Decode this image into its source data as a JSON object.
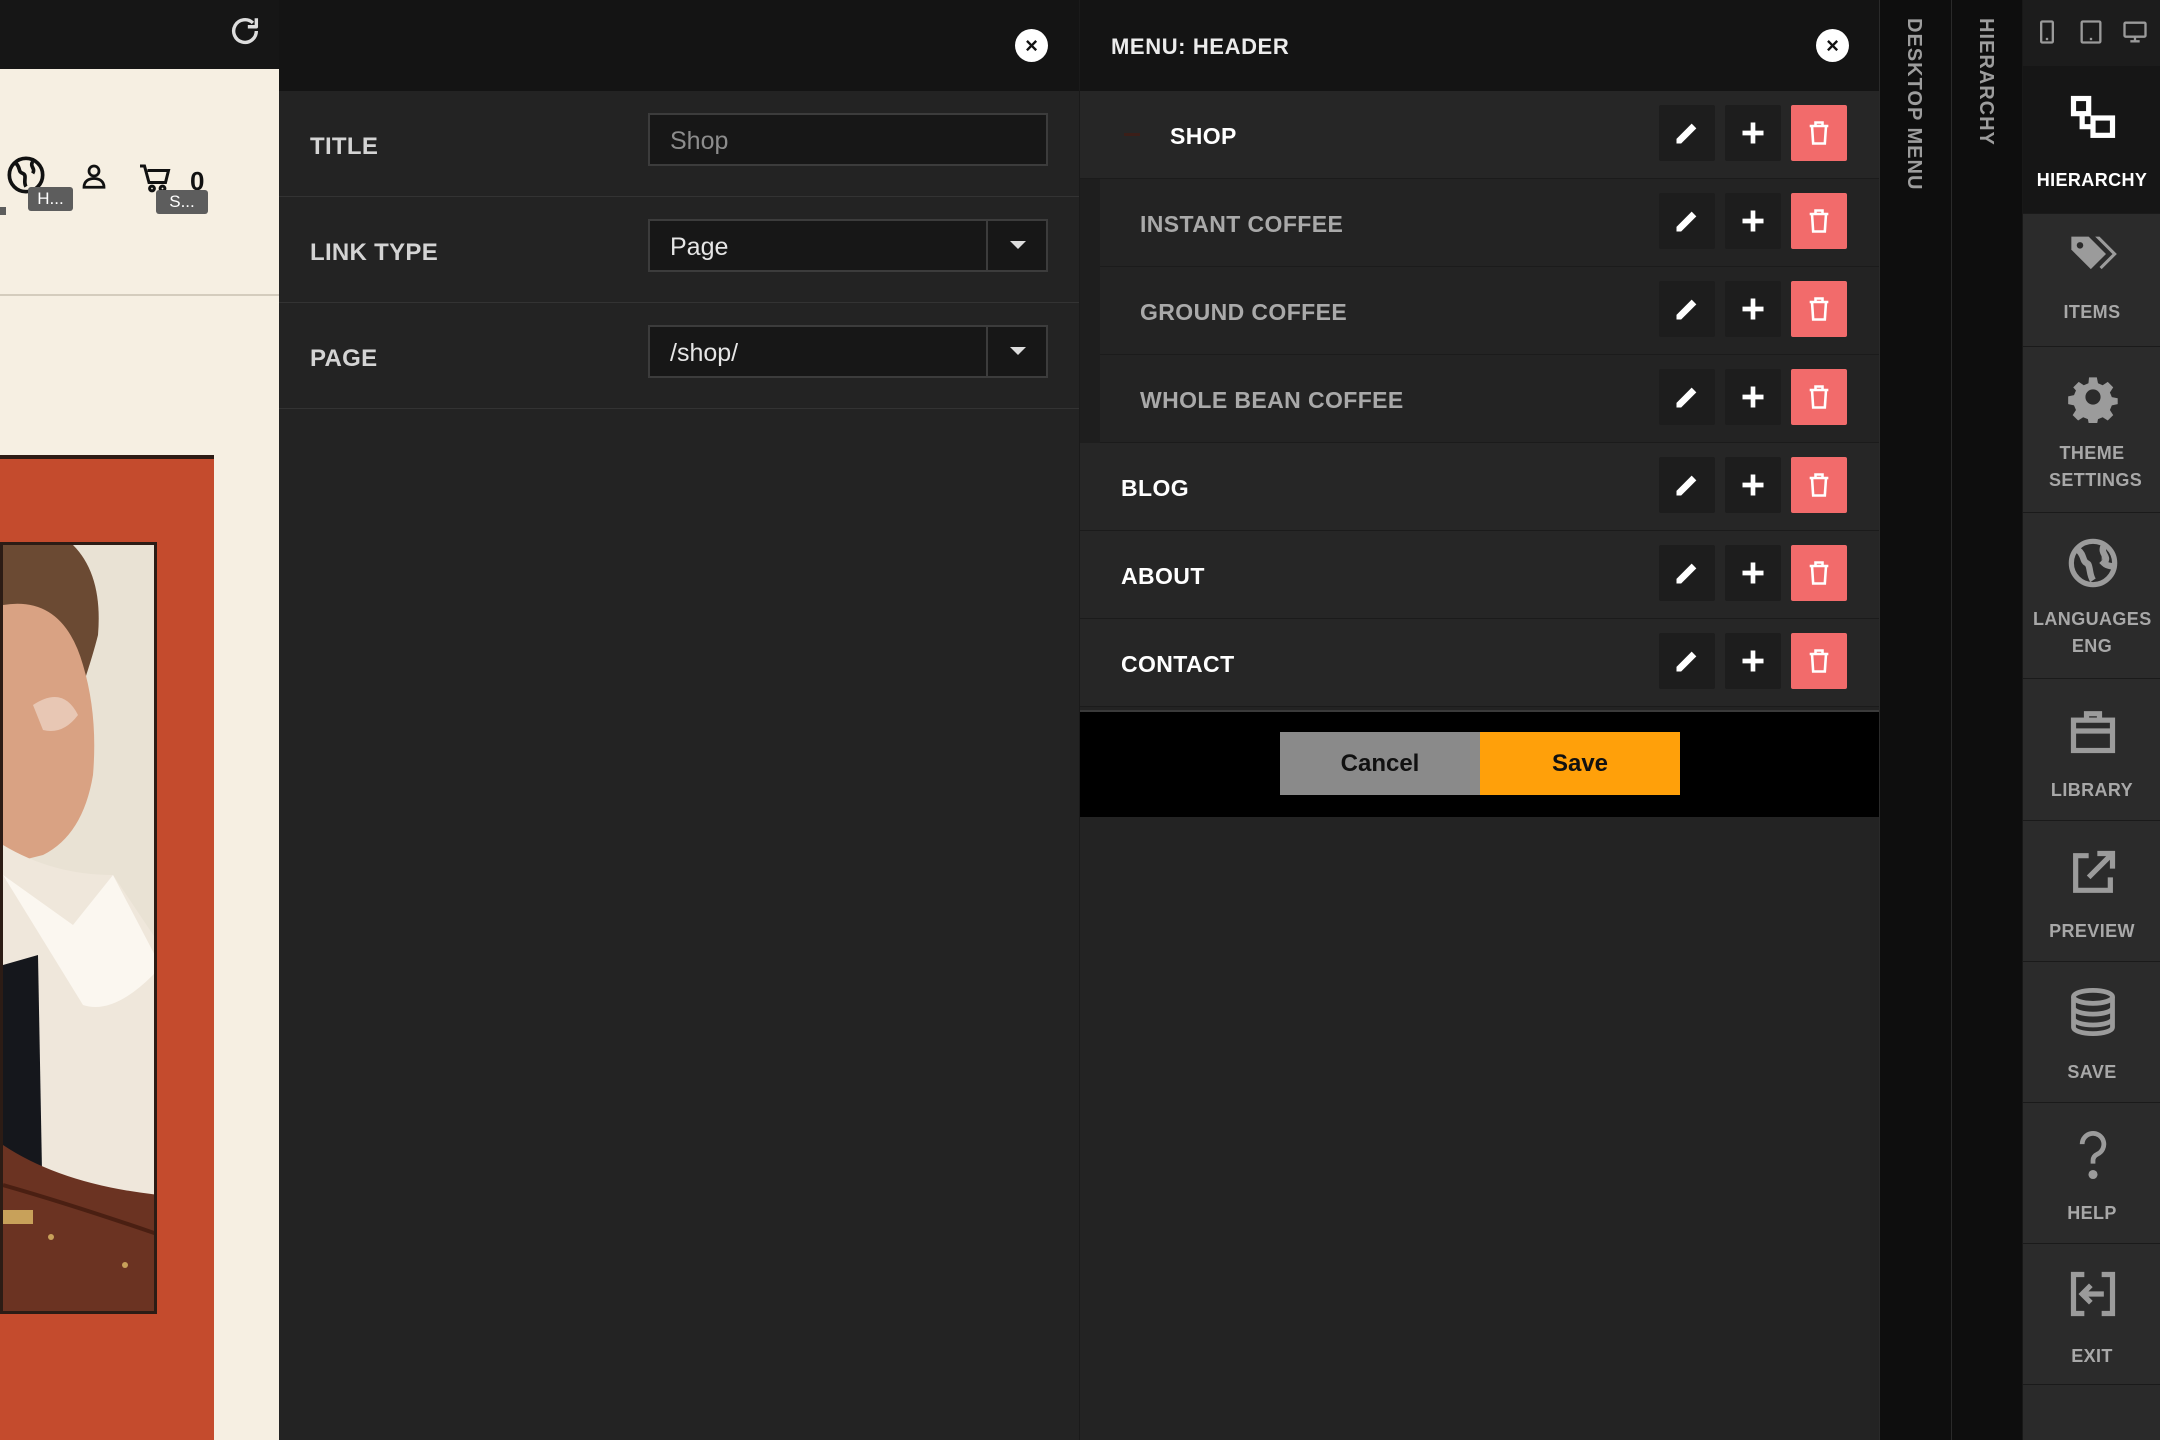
{
  "preview": {
    "language_tag": "H...",
    "cart_tag": "S...",
    "cart_count": "0"
  },
  "link_editor": {
    "fields": [
      {
        "label": "TITLE",
        "value": "Shop"
      },
      {
        "label": "LINK TYPE",
        "value": "Page"
      },
      {
        "label": "PAGE",
        "value": "/shop/"
      }
    ]
  },
  "menu": {
    "title": "MENU: HEADER",
    "items": [
      {
        "label": "SHOP"
      },
      {
        "label": "INSTANT COFFEE"
      },
      {
        "label": "GROUND COFFEE"
      },
      {
        "label": "WHOLE BEAN COFFEE"
      },
      {
        "label": "BLOG"
      },
      {
        "label": "ABOUT"
      },
      {
        "label": "CONTACT"
      }
    ],
    "cancel_label": "Cancel",
    "save_label": "Save"
  },
  "vertical_tabs": {
    "desktop_menu": "DESKTOP MENU",
    "hierarchy": "HIERARCHY"
  },
  "toolbar": {
    "items": [
      {
        "label": "HIERARCHY",
        "icon": "hierarchy-icon"
      },
      {
        "label": "ITEMS",
        "icon": "tags-icon"
      },
      {
        "label": "THEME SETTINGS",
        "icon": "gear-icon"
      },
      {
        "label": "LANGUAGES ENG",
        "icon": "globe-icon"
      },
      {
        "label": "LIBRARY",
        "icon": "briefcase-icon"
      },
      {
        "label": "PREVIEW",
        "icon": "external-link-icon"
      },
      {
        "label": "SAVE",
        "icon": "database-icon"
      },
      {
        "label": "HELP",
        "icon": "question-icon"
      },
      {
        "label": "EXIT",
        "icon": "exit-icon"
      }
    ]
  },
  "colors": {
    "accent": "#ffa00a",
    "delete": "#f26b6b",
    "hero_background": "#c44b2d"
  }
}
